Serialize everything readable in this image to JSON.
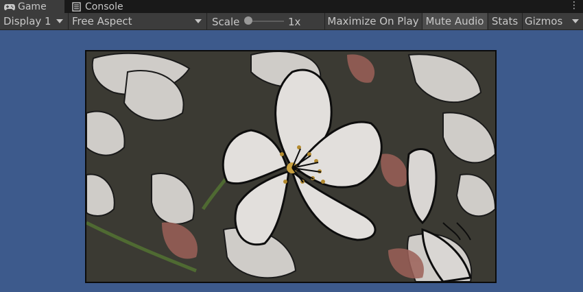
{
  "tabs": [
    {
      "label": "Game",
      "icon": "gamepad-icon",
      "active": true
    },
    {
      "label": "Console",
      "icon": "console-icon",
      "active": false
    }
  ],
  "toolbar": {
    "display": "Display 1",
    "aspect": "Free Aspect",
    "scale_label": "Scale",
    "scale_value": "1x",
    "maximize_on_play": "Maximize On Play",
    "mute_audio": "Mute Audio",
    "stats": "Stats",
    "gizmos": "Gizmos"
  },
  "colors": {
    "game_view_background": "#3d5a8c",
    "toolbar": "#3c3c3c",
    "tab_bar": "#191919",
    "active_toggle": "#4d4d4d"
  },
  "game_view": {
    "content": "cherry-blossom-image"
  }
}
